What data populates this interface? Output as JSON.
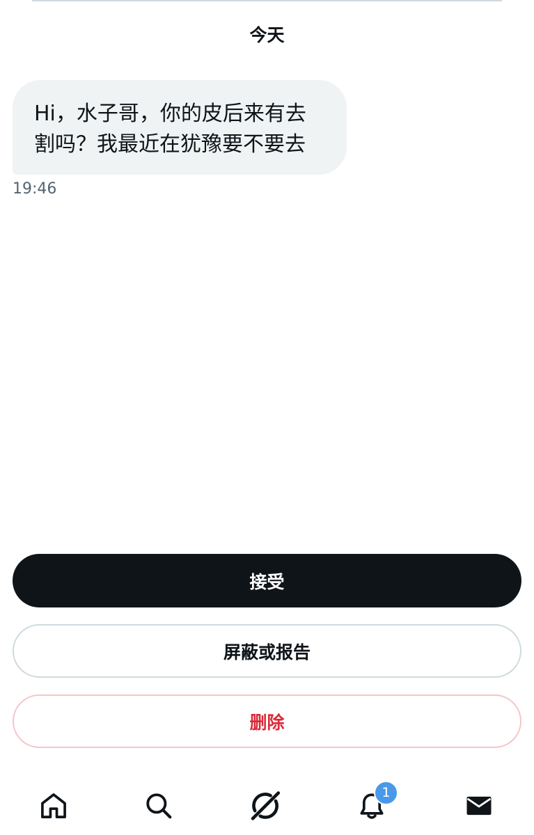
{
  "conversation": {
    "date_label": "今天",
    "message": {
      "line1": "Hi，水子哥，你的皮后来有去",
      "line2": "割吗？我最近在犹豫要不要去",
      "time": "19:46"
    }
  },
  "actions": {
    "accept_label": "接受",
    "block_report_label": "屏蔽或报告",
    "delete_label": "删除"
  },
  "nav": {
    "items": [
      {
        "icon": "home-icon"
      },
      {
        "icon": "search-icon"
      },
      {
        "icon": "grok-icon"
      },
      {
        "icon": "bell-icon",
        "badge": "1"
      },
      {
        "icon": "mail-icon"
      }
    ]
  },
  "colors": {
    "accept_bg": "#0f1419",
    "delete_text": "#d92b3a",
    "badge": "#4a99e9",
    "bubble_bg": "#eff3f4"
  }
}
